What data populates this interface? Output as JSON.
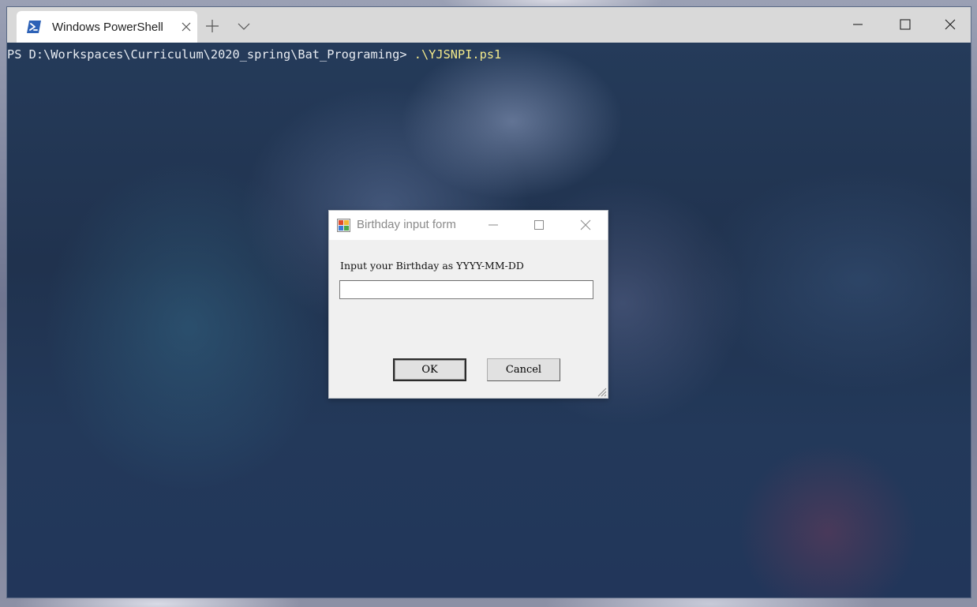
{
  "terminal": {
    "tab": {
      "title": "Windows PowerShell",
      "icon": "powershell-icon"
    },
    "titlebar_buttons": {
      "new_tab": "plus-icon",
      "dropdown": "chevron-down-icon",
      "minimize": "minimize-icon",
      "maximize": "maximize-icon",
      "close": "close-icon"
    },
    "prompt": {
      "path": "PS D:\\Workspaces\\Curriculum\\2020_spring\\Bat_Programing> ",
      "command": ".\\YJSNPI.ps1"
    }
  },
  "dialog": {
    "title": "Birthday input form",
    "app_icon": "form-app-icon",
    "label": "Input your Birthday as YYYY-MM-DD",
    "input": {
      "value": "",
      "placeholder": ""
    },
    "ok_label": "OK",
    "cancel_label": "Cancel"
  },
  "colors": {
    "command_text": "#f3e98a",
    "prompt_text": "#e8ecf2",
    "terminal_background": "#203552",
    "dialog_background": "#f0f0f0",
    "titlebar_background": "#d9d9d9"
  }
}
